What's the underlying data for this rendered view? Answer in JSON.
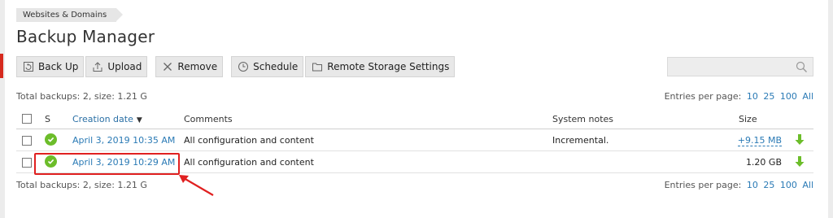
{
  "breadcrumb": "Websites & Domains",
  "title": "Backup Manager",
  "toolbar": {
    "backup": "Back Up",
    "upload": "Upload",
    "remove": "Remove",
    "schedule": "Schedule",
    "remote": "Remote Storage Settings"
  },
  "search": {
    "placeholder": ""
  },
  "summary": "Total backups: 2, size: 1.21 G",
  "pagination": {
    "label": "Entries per page:",
    "options": [
      "10",
      "25",
      "100",
      "All"
    ]
  },
  "table": {
    "headers": {
      "s": "S",
      "date": "Creation date",
      "comments": "Comments",
      "notes": "System notes",
      "size": "Size"
    },
    "rows": [
      {
        "date": "April 3, 2019 10:35 AM",
        "comment": "All configuration and content",
        "notes": "Incremental.",
        "size": "+9.15 MB"
      },
      {
        "date": "April 3, 2019 10:29 AM",
        "comment": "All configuration and content",
        "notes": "",
        "size": "1.20 GB"
      }
    ]
  },
  "colors": {
    "accent": "#2a7ab5",
    "ok": "#6cbd2a",
    "highlight": "#e02020"
  }
}
